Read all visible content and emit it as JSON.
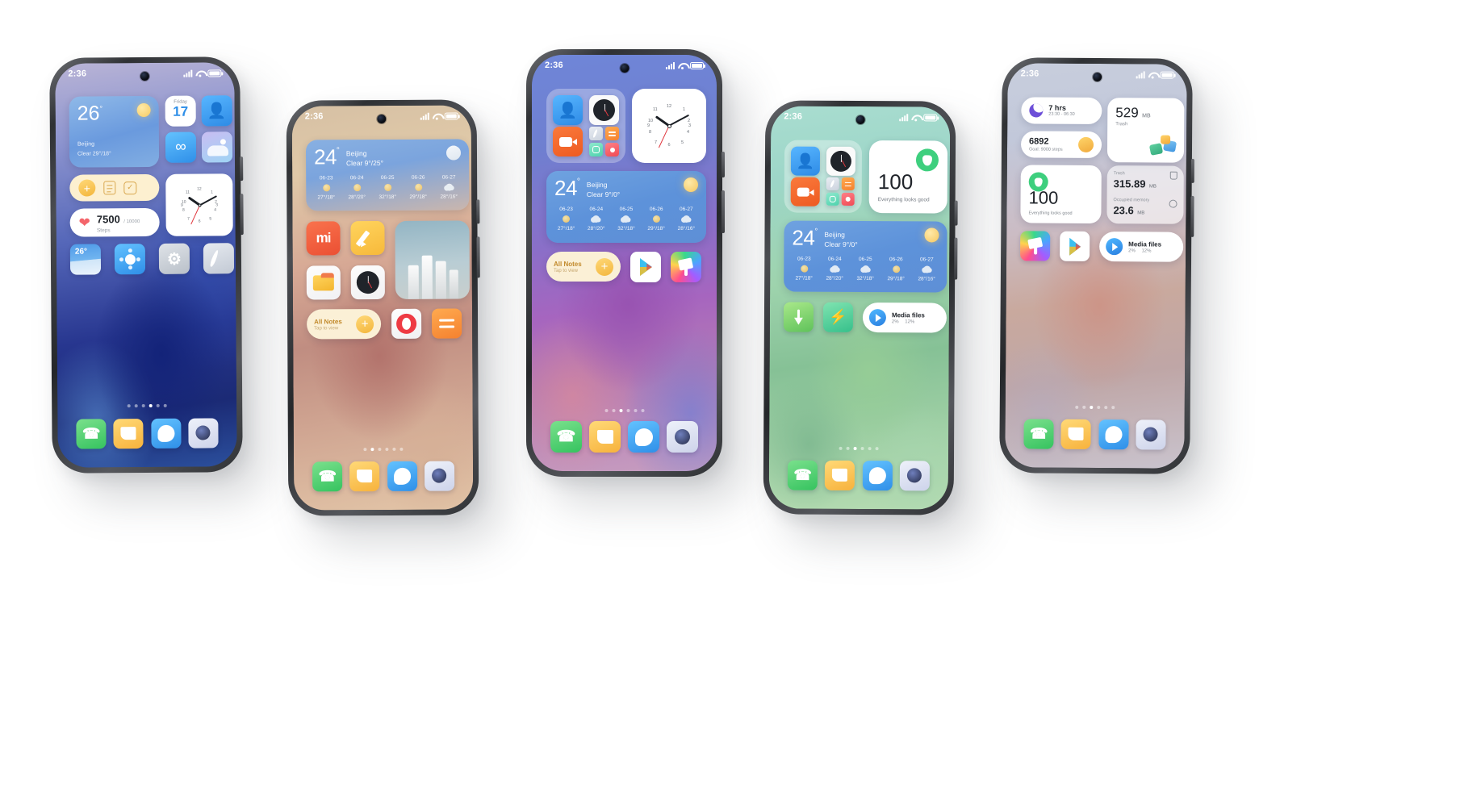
{
  "scene": {
    "title": "MIUI home screen lineup",
    "background": "#ffffff",
    "phone_count": 5
  },
  "status_bar": {
    "time": "2:36",
    "signal": "signal-bars",
    "wifi": "wifi-icon",
    "battery": "battery-icon"
  },
  "phones": [
    {
      "id": "phone-1",
      "theme": "blue-purple",
      "accent": "#2b4f9c",
      "weather_widget": {
        "temp": "26",
        "degree": "°",
        "city": "Beijing",
        "condition": "Clear  29°/18°",
        "icon": "sun-icon"
      },
      "calendar_widget": {
        "weekday": "Friday",
        "day": "17",
        "accent": "#2f8fe8"
      },
      "notes_pill": {
        "add": "+",
        "note_icon": "note-icon",
        "task_icon": "checkbox-icon"
      },
      "steps_widget": {
        "icon": "heart-icon",
        "value": "7500",
        "goal": "/ 10000",
        "label": "Steps"
      },
      "clock_widget": {
        "type": "analog-clock",
        "hour": 10,
        "minute": 10,
        "second": 36
      },
      "app_icons": [
        {
          "name": "weather-icon",
          "label": "26°"
        },
        {
          "name": "remote-control-icon",
          "label": ""
        },
        {
          "name": "settings-icon",
          "label": ""
        },
        {
          "name": "compass-icon",
          "label": ""
        },
        {
          "name": "contacts-icon",
          "label": ""
        },
        {
          "name": "infinity-icon",
          "label": ""
        },
        {
          "name": "gallery-icon",
          "label": ""
        }
      ],
      "dock": [
        "phone-icon",
        "notes-icon",
        "browser-icon",
        "camera-icon"
      ],
      "page_dots": {
        "count": 6,
        "active": 3
      }
    },
    {
      "id": "phone-2",
      "theme": "warm-sand",
      "accent": "#c08d81",
      "weather_widget": {
        "temp": "24",
        "degree": "°",
        "city": "Beijing",
        "condition": "Clear  9°/25°",
        "icon": "cloud-icon",
        "forecast": [
          {
            "date": "06-23",
            "icon": "sun-icon",
            "temps": "27°/18°"
          },
          {
            "date": "06-24",
            "icon": "sun-icon",
            "temps": "28°/20°"
          },
          {
            "date": "06-25",
            "icon": "sun-icon",
            "temps": "32°/18°"
          },
          {
            "date": "06-26",
            "icon": "sun-icon",
            "temps": "29°/18°"
          },
          {
            "date": "06-27",
            "icon": "cloud-icon",
            "temps": "28°/16°"
          }
        ]
      },
      "notes_pill": {
        "title": "All Notes",
        "subtitle": "Tap to view",
        "add": "+"
      },
      "app_icons": [
        {
          "name": "mi-store-icon",
          "label": ""
        },
        {
          "name": "notes-pen-icon",
          "label": ""
        },
        {
          "name": "file-manager-icon",
          "label": ""
        },
        {
          "name": "clock-icon",
          "label": ""
        },
        {
          "name": "opera-icon",
          "label": ""
        },
        {
          "name": "menu-icon",
          "label": ""
        },
        {
          "name": "photo-widget",
          "label": ""
        }
      ],
      "dock": [
        "phone-icon",
        "notes-icon",
        "browser-icon",
        "camera-icon"
      ],
      "page_dots": {
        "count": 6,
        "active": 2
      }
    },
    {
      "id": "phone-3",
      "theme": "violet",
      "accent": "#8a6fc8",
      "widget_stack": [
        "contacts-icon",
        "clock-icon",
        "video-icon",
        "compass-icon",
        "menu-icon",
        "scan-icon",
        "record-icon"
      ],
      "analog_clock": {
        "type": "analog-clock",
        "hour": 10,
        "minute": 10,
        "second": 36
      },
      "weather_widget": {
        "temp": "24",
        "degree": "°",
        "city": "Beijing",
        "condition": "Clear  9°/0°",
        "icon": "sun-icon",
        "forecast": [
          {
            "date": "06-23",
            "icon": "sun-icon",
            "temps": "27°/18°"
          },
          {
            "date": "06-24",
            "icon": "cloud-icon",
            "temps": "28°/20°"
          },
          {
            "date": "06-25",
            "icon": "cloud-icon",
            "temps": "32°/18°"
          },
          {
            "date": "06-26",
            "icon": "sun-icon",
            "temps": "29°/18°"
          },
          {
            "date": "06-27",
            "icon": "cloud-icon",
            "temps": "28°/16°"
          }
        ]
      },
      "notes_pill": {
        "title": "All Notes",
        "subtitle": "Tap to view",
        "add": "+"
      },
      "app_icons": [
        {
          "name": "play-store-icon",
          "label": ""
        },
        {
          "name": "themes-icon",
          "label": ""
        }
      ],
      "dock": [
        "phone-icon",
        "notes-icon",
        "browser-icon",
        "camera-icon"
      ],
      "page_dots": {
        "count": 6,
        "active": 3
      }
    },
    {
      "id": "phone-4",
      "theme": "green",
      "accent": "#4fbf8b",
      "widget_stack": [
        "contacts-icon",
        "clock-icon",
        "video-icon",
        "compass-icon",
        "menu-icon",
        "scan-icon",
        "record-icon"
      ],
      "security_widget": {
        "score": "100",
        "caption": "Everything looks good",
        "icon": "shield-icon",
        "accent": "#3ecf7e"
      },
      "weather_widget": {
        "temp": "24",
        "degree": "°",
        "city": "Beijing",
        "condition": "Clear  9°/0°",
        "icon": "sun-icon",
        "forecast": [
          {
            "date": "06-23",
            "icon": "sun-icon",
            "temps": "27°/18°"
          },
          {
            "date": "06-24",
            "icon": "cloud-icon",
            "temps": "28°/20°"
          },
          {
            "date": "06-25",
            "icon": "cloud-icon",
            "temps": "32°/18°"
          },
          {
            "date": "06-26",
            "icon": "sun-icon",
            "temps": "29°/18°"
          },
          {
            "date": "06-27",
            "icon": "cloud-icon",
            "temps": "28°/16°"
          }
        ]
      },
      "media_widget": {
        "title": "Media files",
        "stat1": "2%",
        "stat2": "12%",
        "icon": "play-icon"
      },
      "app_icons": [
        {
          "name": "download-icon",
          "label": ""
        },
        {
          "name": "booster-icon",
          "label": ""
        }
      ],
      "dock": [
        "phone-icon",
        "notes-icon",
        "browser-icon",
        "camera-icon"
      ],
      "page_dots": {
        "count": 6,
        "active": 3
      }
    },
    {
      "id": "phone-5",
      "theme": "grey-rose",
      "accent": "#b08fb8",
      "sleep_widget": {
        "value": "7 hrs",
        "range": "23:30 - 06:30",
        "icon": "moon-icon"
      },
      "trash_widget": {
        "value": "529",
        "unit": "MB",
        "label": "Trash",
        "icon": "trash-cleanup-icon"
      },
      "steps_widget": {
        "value": "6892",
        "goal": "Goal: 9000 steps",
        "icon": "steps-icon"
      },
      "security_widget": {
        "score": "100",
        "caption": "Everything looks good",
        "icon": "shield-icon",
        "accent": "#3ecf7e"
      },
      "storage_widget": {
        "rows": [
          {
            "label": "Trash",
            "value": "315.89",
            "unit": "MB",
            "icon": "trash-icon"
          },
          {
            "label": "Occupied memory",
            "value": "23.6",
            "unit": "MB",
            "icon": "memory-icon"
          }
        ]
      },
      "media_widget": {
        "title": "Media files",
        "stat1": "2%",
        "stat2": "12%",
        "icon": "play-icon"
      },
      "app_icons": [
        {
          "name": "themes-icon",
          "label": ""
        },
        {
          "name": "play-store-icon",
          "label": ""
        }
      ],
      "dock": [
        "phone-icon",
        "notes-icon",
        "browser-icon",
        "camera-icon"
      ],
      "page_dots": {
        "count": 6,
        "active": 3
      }
    }
  ]
}
